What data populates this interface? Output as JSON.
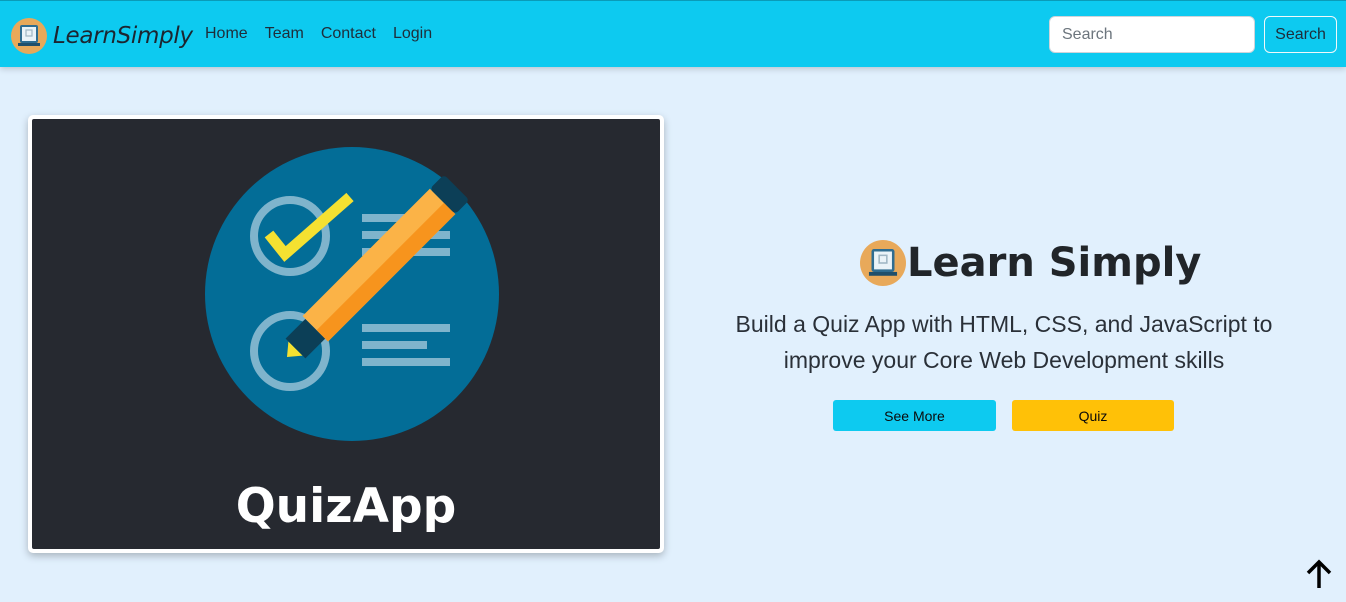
{
  "navbar": {
    "brand": "LearnSimply",
    "links": [
      "Home",
      "Team",
      "Contact",
      "Login"
    ],
    "search_placeholder": "Search",
    "search_button": "Search",
    "color": "#0dcaf0"
  },
  "card": {
    "title": "QuizApp",
    "image_icon": "checklist-pencil-icon"
  },
  "hero": {
    "title": "Learn Simply",
    "description_line1": "Build a Quiz App with HTML, CSS, and JavaScript to",
    "description_line2": "improve your Core Web Development skills",
    "buttons": [
      "See More",
      "Quiz"
    ],
    "see_more_color": "#0dcaf0",
    "quiz_color": "#ffc107"
  },
  "scroll_top_icon": "arrow-up-icon",
  "page_background": "#e1f0fd"
}
